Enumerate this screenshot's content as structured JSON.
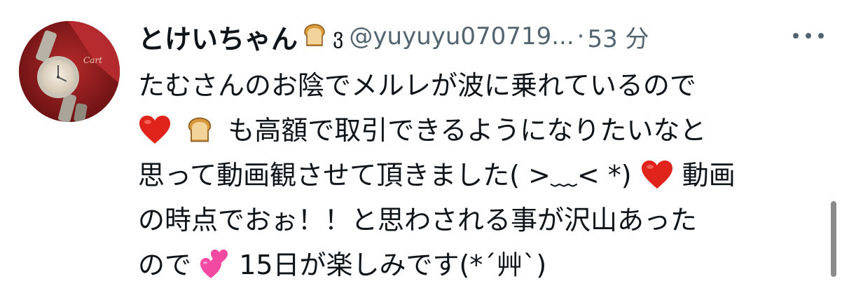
{
  "tweet": {
    "display_name": "とけいちゃん",
    "name_emoji": "bread-emoji",
    "name_suffix": "ვ",
    "handle": "@yuyuyu070719...",
    "separator": "·",
    "timestamp": "53 分",
    "more_icon": "more-horizontal-icon",
    "body_lines": [
      "たむさんのお陰でメルレが波に乗れているので",
      "も高額で取引できるようになりたいなと",
      "思って動画観させて頂きました( >﹏< *)",
      "動画",
      "の時点でおぉ！！と思わされる事が沢山あった",
      "ので",
      "15日が楽しみです(*´艸`)"
    ],
    "emojis": {
      "heart": "red-heart-emoji",
      "bread": "bread-emoji",
      "two_hearts": "two-hearts-emoji"
    }
  },
  "colors": {
    "text_primary": "#0f1419",
    "text_secondary": "#536471",
    "heart": "#e0241b",
    "bread": "#d99a3e",
    "pink_hearts": "#f24aa3"
  }
}
